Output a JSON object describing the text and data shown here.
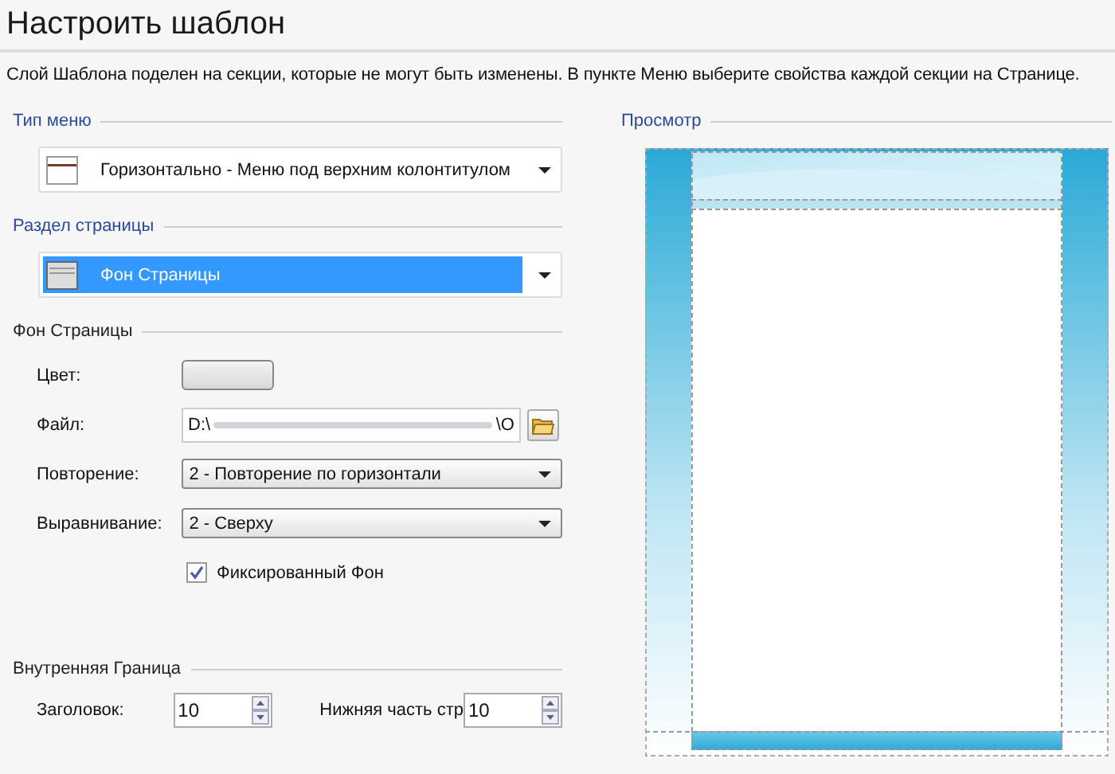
{
  "title": "Настроить шаблон",
  "description": "Слой Шаблона поделен на секции, которые не могут быть изменены. В пункте Меню выберите свойства каждой секции на Странице.",
  "menu_type": {
    "label": "Тип меню",
    "select": {
      "value": "Горизонтально - Меню под верхним колонтитулом",
      "selected": false
    }
  },
  "page_section": {
    "label": "Раздел страницы",
    "select": {
      "value": "Фон Страницы",
      "selected": true
    }
  },
  "background": {
    "label": "Фон Страницы",
    "fields": [
      {
        "kind": "color",
        "label": "Цвет:"
      },
      {
        "kind": "file",
        "label": "Файл:",
        "value_start": "D:\\",
        "value_end": "\\O"
      },
      {
        "kind": "select",
        "label": "Повторение:",
        "value": "2 - Повторение по горизонтали"
      },
      {
        "kind": "select",
        "label": "Выравнивание:",
        "value": "2 - Сверху"
      },
      {
        "kind": "checkbox",
        "label": "Фиксированный Фон",
        "checked": true
      }
    ]
  },
  "inner_border": {
    "label": "Внутренняя Граница",
    "spinners": [
      {
        "label": "Заголовок:",
        "value": "10"
      },
      {
        "label": "Нижняя часть стр",
        "value": "10"
      }
    ]
  },
  "preview": {
    "label": "Просмотр"
  }
}
